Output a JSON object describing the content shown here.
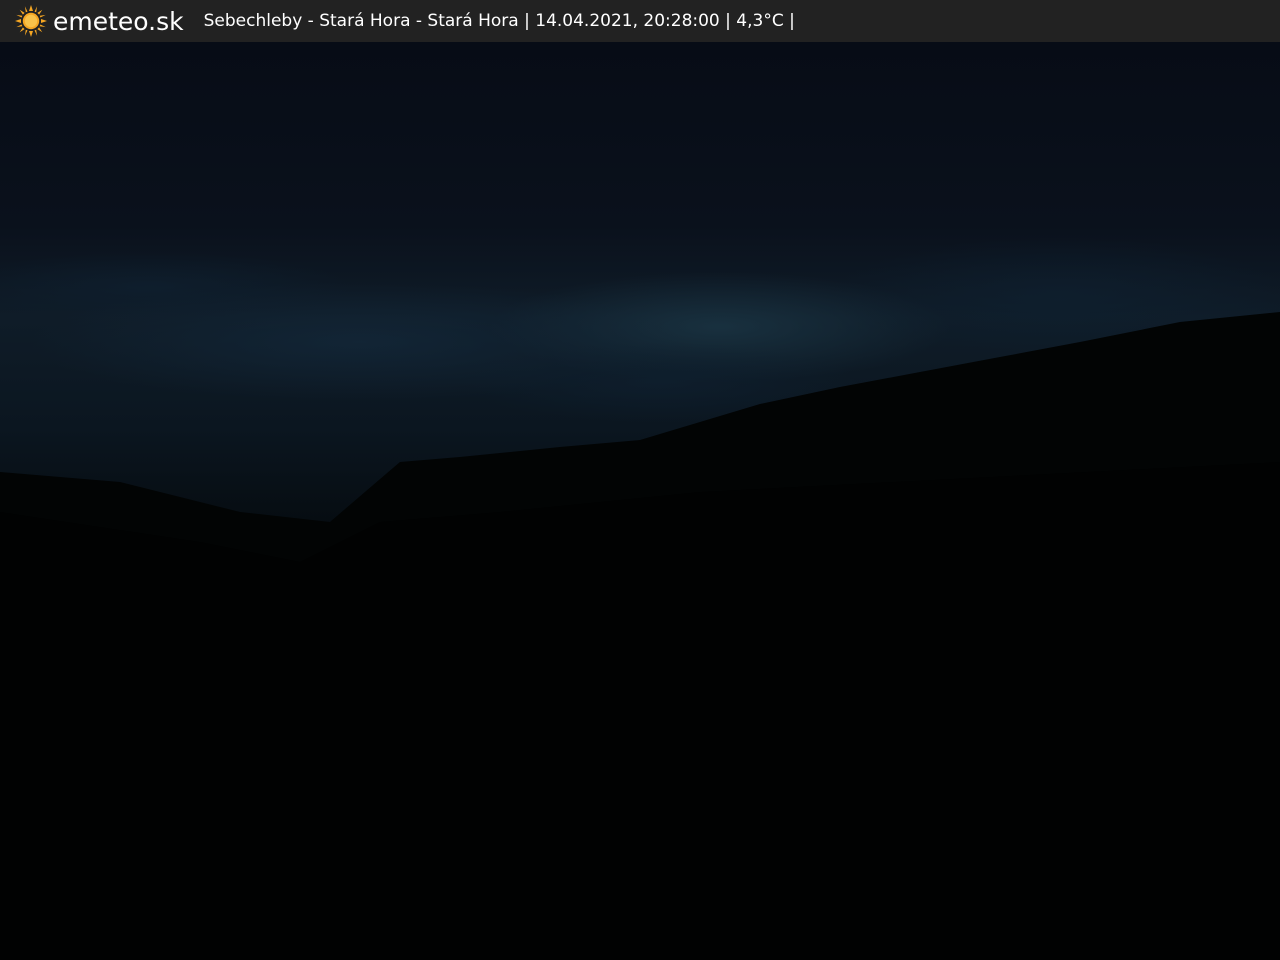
{
  "header": {
    "brand": "emeteo.sk",
    "icon": "sun-icon",
    "location": "Sebechleby - Stará Hora - Stará Hora",
    "datetime": "14.04.2021, 20:28:00",
    "temperature": "4,3°C"
  },
  "colors": {
    "bar_background": "#222222",
    "sun": "#f5a623",
    "text": "#ffffff"
  }
}
